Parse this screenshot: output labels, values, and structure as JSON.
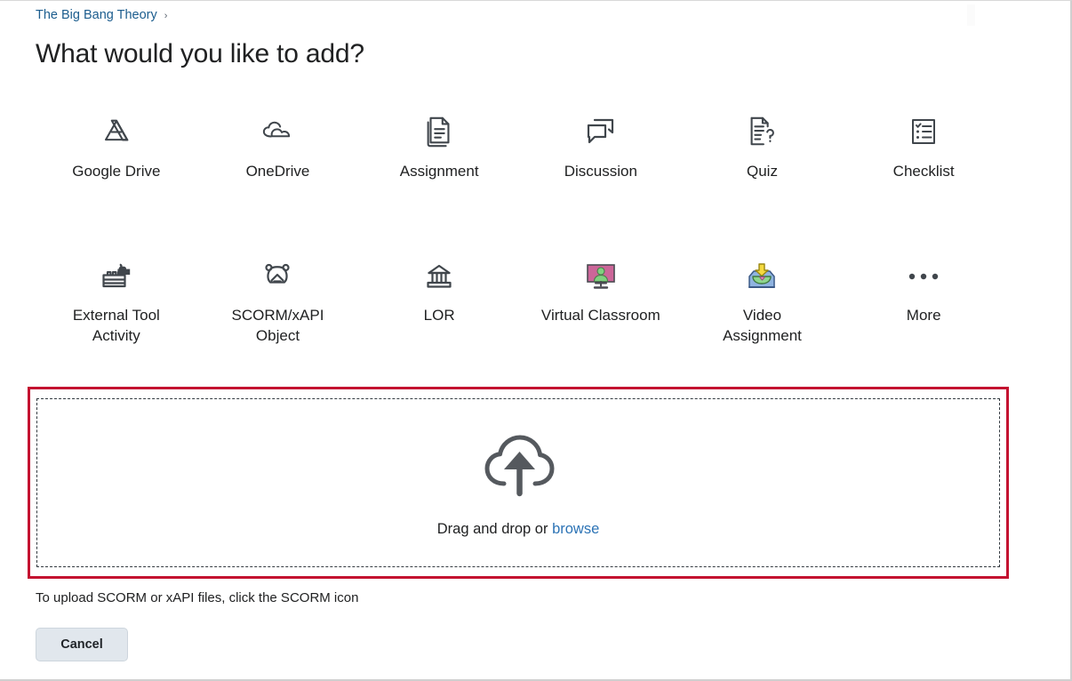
{
  "breadcrumb": {
    "course": "The Big Bang Theory",
    "separator": "›"
  },
  "page_title": "What would you like to add?",
  "tools_row1": [
    {
      "label": "Google Drive",
      "icon": "google-drive-icon"
    },
    {
      "label": "OneDrive",
      "icon": "onedrive-cloud-icon"
    },
    {
      "label": "Assignment",
      "icon": "assignment-document-icon"
    },
    {
      "label": "Discussion",
      "icon": "discussion-speech-bubbles-icon"
    },
    {
      "label": "Quiz",
      "icon": "quiz-question-document-icon"
    },
    {
      "label": "Checklist",
      "icon": "checklist-icon"
    }
  ],
  "tools_row2": [
    {
      "label": "External Tool Activity",
      "icon": "external-tool-lego-icon"
    },
    {
      "label": "SCORM/xAPI Object",
      "icon": "scorm-xapi-icon"
    },
    {
      "label": "LOR",
      "icon": "lor-bank-building-icon"
    },
    {
      "label": "Virtual Classroom",
      "icon": "virtual-classroom-monitor-icon"
    },
    {
      "label": "Video Assignment",
      "icon": "video-assignment-inbox-icon"
    },
    {
      "label": "More",
      "icon": "more-ellipsis-icon"
    }
  ],
  "dropzone": {
    "icon": "cloud-upload-icon",
    "text_prefix": "Drag and drop or ",
    "browse_label": "browse"
  },
  "hint_text": "To upload SCORM or xAPI files, click the SCORM icon",
  "cancel_label": "Cancel",
  "colors": {
    "link": "#1c5d8e",
    "browse_link": "#2c73b5",
    "highlight_border": "#c41230",
    "icon_dark": "#40464c",
    "virtual_classroom_screen": "#cc6699",
    "virtual_classroom_person": "#7fd07f",
    "video_tray": "#8fb3e0",
    "video_arrow": "#f5d93f",
    "cancel_bg": "#e1e7ed"
  }
}
